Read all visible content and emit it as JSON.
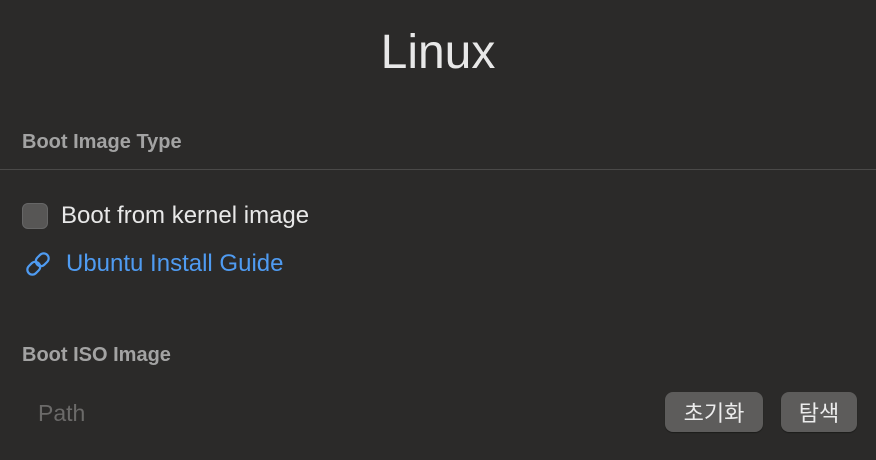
{
  "page": {
    "title": "Linux"
  },
  "boot_image_type": {
    "label": "Boot Image Type",
    "kernel_checkbox": {
      "label": "Boot from kernel image",
      "checked": false
    },
    "guide_link": {
      "label": "Ubuntu Install Guide",
      "icon": "link-icon"
    }
  },
  "boot_iso_image": {
    "label": "Boot ISO Image",
    "path_placeholder": "Path",
    "path_value": "",
    "reset_label": "초기화",
    "browse_label": "탐색"
  },
  "colors": {
    "background": "#2b2a29",
    "link": "#4f9bf1",
    "section_label": "#a3a3a3",
    "button": "#5d5c5b"
  }
}
